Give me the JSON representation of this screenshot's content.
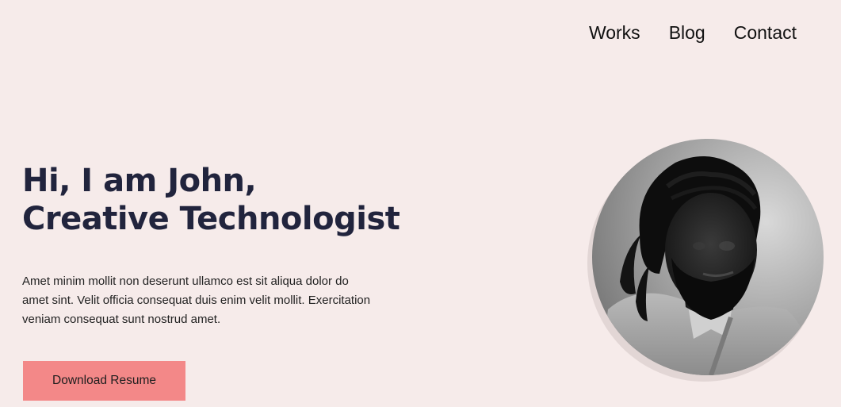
{
  "nav": {
    "items": [
      {
        "label": "Works"
      },
      {
        "label": "Blog"
      },
      {
        "label": "Contact"
      }
    ]
  },
  "hero": {
    "title_line1": "Hi, I am John,",
    "title_line2": "Creative Technologist",
    "body_lines": [
      "Amet minim mollit non deserunt ullamco est sit aliqua dolor do",
      "amet sint. Velit officia consequat duis enim velit mollit. Exercitation",
      "veniam consequat sunt nostrud amet."
    ],
    "button_label": "Download Resume"
  },
  "colors": {
    "background": "#f6ebea",
    "title": "#21243d",
    "button": "#f38888",
    "avatar_shadow": "#e2d6d5"
  },
  "avatar": {
    "description_icon": "portrait-photo"
  }
}
